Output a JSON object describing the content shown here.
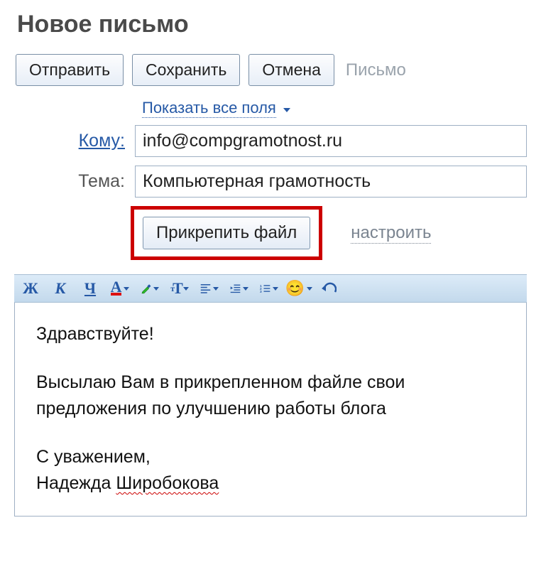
{
  "title": "Новое письмо",
  "toolbar": {
    "send": "Отправить",
    "save": "Сохранить",
    "cancel": "Отмена",
    "tab_label": "Письмо"
  },
  "show_all_fields": "Показать все поля",
  "fields": {
    "to_label": "Кому:",
    "to_value": "info@compgramotnost.ru",
    "subject_label": "Тема:",
    "subject_value": "Компьютерная грамотность"
  },
  "attach": {
    "button": "Прикрепить файл",
    "configure": "настроить"
  },
  "body": {
    "p1": "Здравствуйте!",
    "p2": "Высылаю Вам в прикрепленном файле свои предложения по улучшению работы блога",
    "p3a": "С уважением,",
    "p3b": "Надежда ",
    "p3c": "Широбокова"
  }
}
